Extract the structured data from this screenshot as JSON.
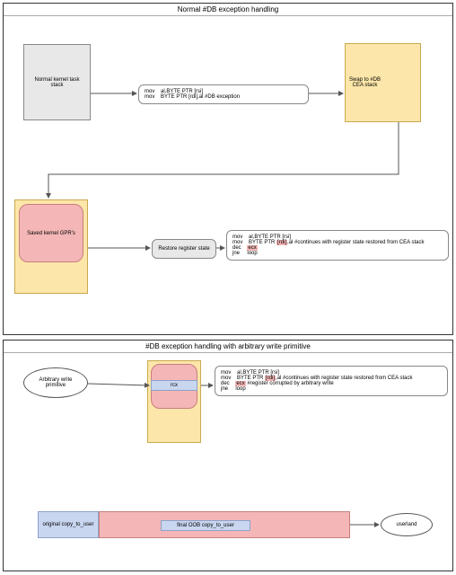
{
  "sections": [
    {
      "title": "Normal #DB exception handling"
    },
    {
      "title": "#DB exception handling with arbitrary write primitive"
    }
  ],
  "boxes": {
    "kernel_stack": "Normal kernel task\nstack",
    "cea_stack": "Swap to #DB\nCEA stack",
    "saved_gpr": "Saved kernel GPR's",
    "restore": "Restore register state",
    "arb_write": "Arbitrary write\nprimitive",
    "rcx": "rcx",
    "orig_copy": "original copy_to_user",
    "oob_copy": "final OOB copy_to_user",
    "userland": "userland"
  },
  "code1": {
    "l1a": "mov",
    "l1b": "al,BYTE PTR [rsi]",
    "l2a": "mov",
    "l2b": "BYTE PTR [rdi],al #DB exception"
  },
  "code2": {
    "l1a": "mov",
    "l1b": "al,BYTE PTR [rsi]",
    "l2a": "mov",
    "l2b": "BYTE PTR ",
    "l2r": "[rdi]",
    "l2c": ",al #continues with register state restored from CEA stack",
    "blank": "",
    "l3a": "dec",
    "l3r": "ecx",
    "l4a": "jne",
    "l4b": "loop"
  },
  "code3": {
    "l1a": "mov",
    "l1b": "al,BYTE PTR [rsi]",
    "l2a": "mov",
    "l2b": "BYTE PTR ",
    "l2r": "[rdi]",
    "l2c": ",al #continues with register state restored from CEA stack",
    "blank": "",
    "l3a": "dec",
    "l3r": "ecx",
    "l3b": " #register corrupted by arbitrary write",
    "l4a": "jne",
    "l4b": "loop"
  }
}
